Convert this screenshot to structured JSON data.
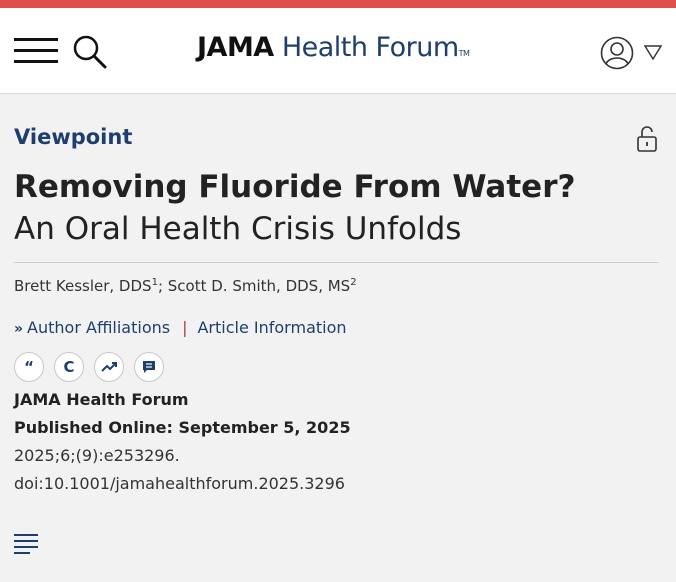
{
  "header": {
    "brand_journal": "JAMA",
    "brand_section": "Health Forum",
    "brand_tm": "TM",
    "icons": [
      "menu-icon",
      "search-icon",
      "user-icon",
      "caret-down-icon"
    ],
    "accent_color": "#e0504b",
    "brand_color": "#1e3f6e"
  },
  "article": {
    "type": "Viewpoint",
    "lock_icon": "unlocked-lock-icon",
    "title": "Removing Fluoride From Water?",
    "subtitle": "An Oral Health Crisis Unfolds",
    "authors": [
      {
        "name": "Brett Kessler, DDS",
        "affiliation": "1"
      },
      {
        "name": "Scott D. Smith, DDS, MS",
        "affiliation": "2"
      }
    ],
    "author_separator": ";",
    "links": {
      "affiliations": "Author Affiliations",
      "separator": "|",
      "information": "Article Information"
    },
    "tools": [
      {
        "icon": "quote-icon",
        "glyph": "“"
      },
      {
        "icon": "copyright-icon",
        "glyph": "C"
      },
      {
        "icon": "trending-icon",
        "glyph": ""
      },
      {
        "icon": "comment-icon",
        "glyph": ""
      }
    ],
    "journal": "JAMA Health Forum",
    "published": "Published Online: September 5, 2025",
    "citation": "2025;6;(9):e253296.",
    "doi": "doi:10.1001/jamahealthforum.2025.3296"
  },
  "footer": {
    "toc_icon": "table-of-contents-icon"
  }
}
